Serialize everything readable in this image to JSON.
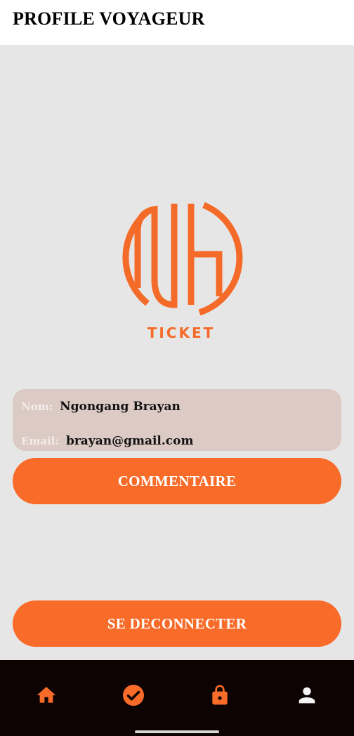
{
  "header": {
    "title": "PROFILE VOYAGEUR"
  },
  "logo": {
    "text": "TICKET",
    "color": "#f46a28"
  },
  "profile": {
    "name_label": "Nom:",
    "name_value": "Ngongang Brayan",
    "email_label": "Email:",
    "email_value": "brayan@gmail.com"
  },
  "actions": {
    "comment_label": "COMMENTAIRE",
    "logout_label": "SE DECONNECTER"
  },
  "bottom_nav": {
    "items": [
      {
        "icon": "home-icon",
        "selected": false
      },
      {
        "icon": "check-circle-icon",
        "selected": false
      },
      {
        "icon": "lock-icon",
        "selected": false
      },
      {
        "icon": "person-icon",
        "selected": true
      }
    ]
  },
  "colors": {
    "accent": "#f96b29",
    "background": "#e7e6e6",
    "card": "#dccac4",
    "nav_bg": "#0e0303"
  }
}
